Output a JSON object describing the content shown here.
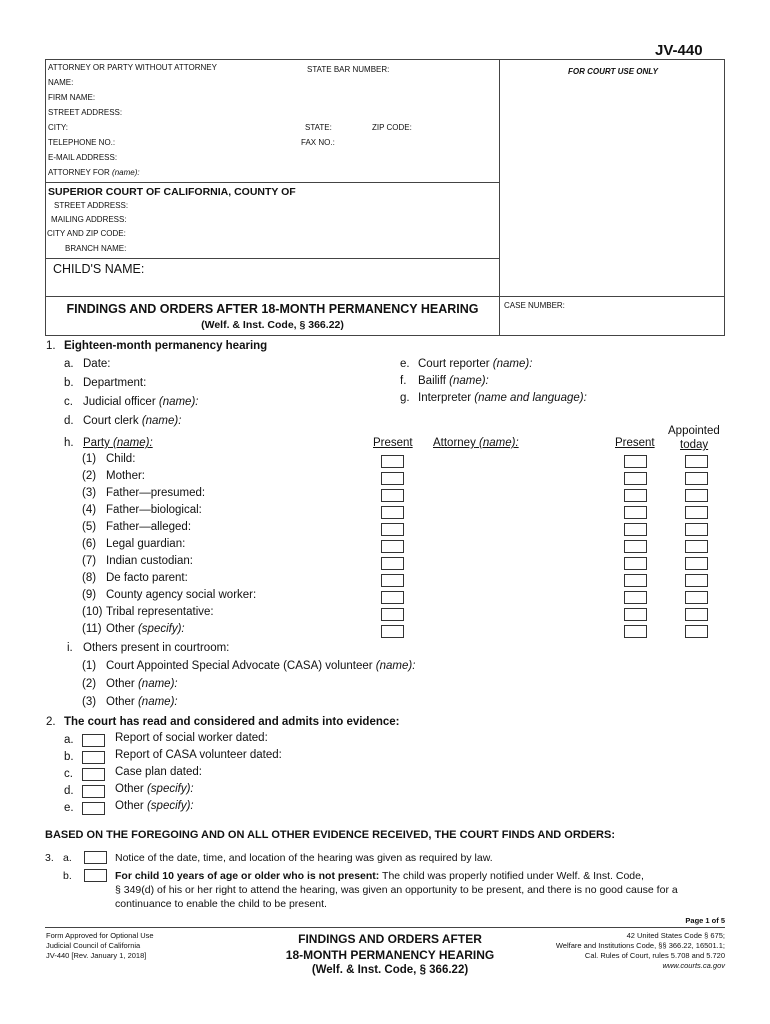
{
  "form_id": "JV-440",
  "header": {
    "attorney_label": "ATTORNEY OR PARTY WITHOUT ATTORNEY",
    "state_bar_label": "STATE BAR NUMBER:",
    "for_court_use": "FOR COURT USE ONLY",
    "name_label": "NAME:",
    "firm_label": "FIRM NAME:",
    "street_label": "STREET ADDRESS:",
    "city_label": "CITY:",
    "state_label": "STATE:",
    "zip_label": "ZIP CODE:",
    "phone_label": "TELEPHONE NO.:",
    "fax_label": "FAX NO.:",
    "email_label": "E-MAIL ADDRESS:",
    "attorney_for_label": "ATTORNEY FOR",
    "attorney_for_hint": "(name):",
    "court_title": "SUPERIOR COURT OF CALIFORNIA, COUNTY OF",
    "court_street": "STREET ADDRESS:",
    "court_mailing": "MAILING ADDRESS:",
    "court_city_zip": "CITY AND ZIP CODE:",
    "court_branch": "BRANCH NAME:",
    "child_name_label": "CHILD'S NAME:",
    "title": "FINDINGS AND ORDERS AFTER 18-MONTH PERMANENCY HEARING",
    "subtitle": "(Welf. & Inst. Code, § 366.22)",
    "case_number_label": "CASE NUMBER:"
  },
  "section1": {
    "num": "1.",
    "heading": "Eighteen-month permanency hearing",
    "left_items": [
      {
        "letter": "a.",
        "label": "Date:",
        "hint": ""
      },
      {
        "letter": "b.",
        "label": "Department:",
        "hint": ""
      },
      {
        "letter": "c.",
        "label": "Judicial officer",
        "hint": "(name):"
      },
      {
        "letter": "d.",
        "label": "Court clerk",
        "hint": "(name):"
      }
    ],
    "right_items": [
      {
        "letter": "e.",
        "label": "Court reporter",
        "hint": "(name):"
      },
      {
        "letter": "f.",
        "label": "Bailiff",
        "hint": "(name):"
      },
      {
        "letter": "g.",
        "label": "Interpreter",
        "hint": "(name and language):"
      }
    ],
    "party": {
      "letter": "h.",
      "label": "Party",
      "hint": "(name):",
      "col_present": "Present",
      "col_attorney": "Attorney",
      "col_attorney_hint": "(name):",
      "col_attorney_present": "Present",
      "col_appointed_1": "Appointed",
      "col_appointed_2": "today",
      "rows": [
        {
          "num": "(1)",
          "label": "Child:",
          "hint": ""
        },
        {
          "num": "(2)",
          "label": "Mother:",
          "hint": ""
        },
        {
          "num": "(3)",
          "label": "Father—presumed:",
          "hint": ""
        },
        {
          "num": "(4)",
          "label": "Father—biological:",
          "hint": ""
        },
        {
          "num": "(5)",
          "label": "Father—alleged:",
          "hint": ""
        },
        {
          "num": "(6)",
          "label": "Legal guardian:",
          "hint": ""
        },
        {
          "num": "(7)",
          "label": "Indian custodian:",
          "hint": ""
        },
        {
          "num": "(8)",
          "label": "De facto parent:",
          "hint": ""
        },
        {
          "num": "(9)",
          "label": "County agency social worker:",
          "hint": ""
        },
        {
          "num": "(10)",
          "label": "Tribal representative:",
          "hint": ""
        },
        {
          "num": "(11)",
          "label": "Other",
          "hint": "(specify):"
        }
      ]
    },
    "others": {
      "letter": "i.",
      "label": "Others present in courtroom:",
      "rows": [
        {
          "num": "(1)",
          "label": "Court Appointed Special Advocate (CASA) volunteer",
          "hint": "(name):"
        },
        {
          "num": "(2)",
          "label": "Other",
          "hint": "(name):"
        },
        {
          "num": "(3)",
          "label": "Other",
          "hint": "(name):"
        }
      ]
    }
  },
  "section2": {
    "num": "2.",
    "heading": "The court has read and considered and admits into evidence:",
    "items": [
      {
        "letter": "a.",
        "label": "Report of social worker dated:",
        "hint": ""
      },
      {
        "letter": "b.",
        "label": "Report of CASA volunteer dated:",
        "hint": ""
      },
      {
        "letter": "c.",
        "label": "Case plan dated:",
        "hint": ""
      },
      {
        "letter": "d.",
        "label": "Other",
        "hint": "(specify):"
      },
      {
        "letter": "e.",
        "label": "Other",
        "hint": "(specify):"
      }
    ]
  },
  "findings_heading": "BASED ON THE FOREGOING AND ON ALL OTHER EVIDENCE RECEIVED, THE COURT FINDS AND ORDERS:",
  "section3": {
    "num": "3.",
    "a_letter": "a.",
    "a_text": "Notice of the date, time, and location of the hearing was given as required by law.",
    "b_letter": "b.",
    "b_bold": "For child 10 years of age or older who is not present:",
    "b_text_1": " The child was properly notified under Welf. & Inst. Code,",
    "b_text_2": "§ 349(d) of his or her right to attend the hearing, was given an opportunity to be present, and there is no good cause for a",
    "b_text_3": "continuance to enable the child to be present."
  },
  "footer": {
    "page": "Page 1 of 5",
    "left_1": "Form Approved for Optional Use",
    "left_2": "Judicial Council of California",
    "left_3": "JV-440 [Rev. January 1, 2018]",
    "title_1": "FINDINGS AND ORDERS AFTER",
    "title_2": "18-MONTH PERMANENCY HEARING",
    "title_3": "(Welf. & Inst. Code, § 366.22)",
    "right_1": "42 United States Code § 675;",
    "right_2": "Welfare and Institutions Code, §§ 366.22, 16501.1;",
    "right_3": "Cal. Rules of Court, rules 5.708 and  5.720",
    "right_4": "www.courts.ca.gov"
  }
}
